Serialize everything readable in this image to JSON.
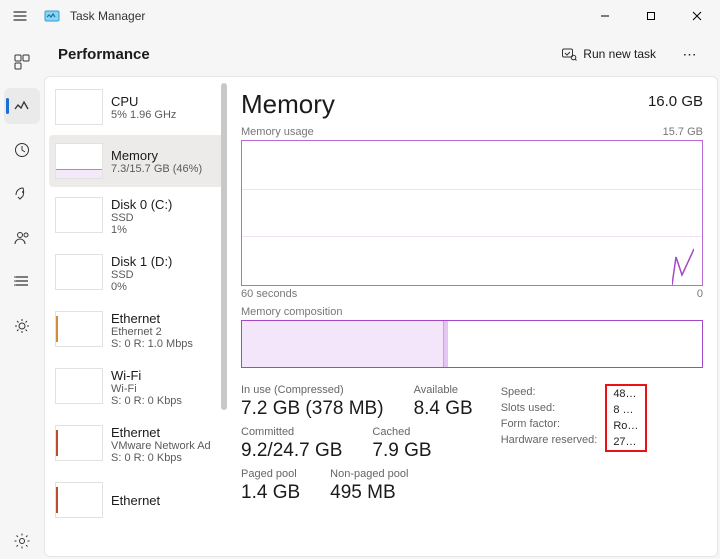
{
  "app": {
    "title": "Task Manager"
  },
  "header": {
    "page": "Performance",
    "run_new_task": "Run new task"
  },
  "sidebar": {
    "items": [
      {
        "name": "CPU",
        "sub1": "5%  1.96 GHz"
      },
      {
        "name": "Memory",
        "sub1": "7.3/15.7 GB (46%)"
      },
      {
        "name": "Disk 0 (C:)",
        "sub1": "SSD",
        "sub2": "1%"
      },
      {
        "name": "Disk 1 (D:)",
        "sub1": "SSD",
        "sub2": "0%"
      },
      {
        "name": "Ethernet",
        "sub1": "Ethernet 2",
        "sub2": "S: 0  R: 1.0 Mbps"
      },
      {
        "name": "Wi-Fi",
        "sub1": "Wi-Fi",
        "sub2": "S: 0  R: 0 Kbps"
      },
      {
        "name": "Ethernet",
        "sub1": "VMware Network Ad",
        "sub2": "S: 0  R: 0 Kbps"
      },
      {
        "name": "Ethernet",
        "sub1": "",
        "sub2": ""
      }
    ]
  },
  "detail": {
    "title": "Memory",
    "total": "16.0 GB",
    "usage_label": "Memory usage",
    "usage_max": "15.7 GB",
    "axis_left": "60 seconds",
    "axis_right": "0",
    "composition_label": "Memory composition",
    "stats": {
      "in_use_label": "In use (Compressed)",
      "in_use": "7.2 GB (378 MB)",
      "available_label": "Available",
      "available": "8.4 GB",
      "committed_label": "Committed",
      "committed": "9.2/24.7 GB",
      "cached_label": "Cached",
      "cached": "7.9 GB",
      "paged_label": "Paged pool",
      "paged": "1.4 GB",
      "nonpaged_label": "Non-paged pool",
      "nonpaged": "495 MB"
    },
    "props": {
      "speed_label": "Speed:",
      "speed": "48…",
      "slots_label": "Slots used:",
      "slots": "8 o…",
      "form_label": "Form factor:",
      "form": "Ro…",
      "hw_label": "Hardware reserved:",
      "hw": "27…"
    }
  }
}
